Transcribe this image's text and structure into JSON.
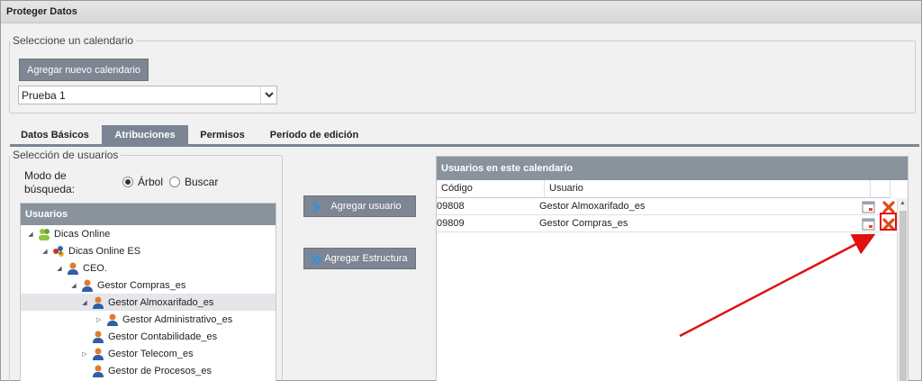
{
  "window": {
    "title": "Proteger Datos"
  },
  "calendar_section": {
    "legend": "Seleccione un calendario",
    "add_button": "Agregar nuevo calendario",
    "selected_calendar": "Prueba 1"
  },
  "tabs": [
    {
      "label": "Datos Básicos",
      "active": false
    },
    {
      "label": "Atribuciones",
      "active": true
    },
    {
      "label": "Permisos",
      "active": false
    },
    {
      "label": "Período de edición",
      "active": false
    }
  ],
  "user_selection": {
    "legend": "Selección de usuarios",
    "mode_label": "Modo de búsqueda:",
    "mode_options": [
      {
        "label": "Árbol",
        "selected": true
      },
      {
        "label": "Buscar",
        "selected": false
      }
    ],
    "tree_header": "Usuarios",
    "tree_nodes": [
      {
        "label": "Dicas Online",
        "caret": "expanded",
        "icon": "group-icon"
      },
      {
        "label": "Dicas Online ES",
        "caret": "expanded",
        "icon": "organization-icon"
      },
      {
        "label": "CEO.",
        "caret": "expanded",
        "icon": "user-icon"
      },
      {
        "label": "Gestor Compras_es",
        "caret": "expanded",
        "icon": "user-icon"
      },
      {
        "label": "Gestor Almoxarifado_es",
        "caret": "expanded",
        "icon": "user-icon",
        "selected": true
      },
      {
        "label": "Gestor Administrativo_es",
        "caret": "collapsed",
        "icon": "user-icon"
      },
      {
        "label": "Gestor Contabilidade_es",
        "caret": "none",
        "icon": "user-icon"
      },
      {
        "label": "Gestor Telecom_es",
        "caret": "collapsed",
        "icon": "user-icon"
      },
      {
        "label": "Gestor de Procesos_es",
        "caret": "none",
        "icon": "user-icon"
      }
    ]
  },
  "actions": {
    "add_user": "Agregar usuario",
    "add_structure": "Agregar Estructura"
  },
  "users_in_calendar": {
    "header": "Usuarios en este calendario",
    "columns": [
      "Código",
      "Usuario"
    ],
    "rows": [
      {
        "code": "09808",
        "user": "Gestor Almoxarifado_es"
      },
      {
        "code": "09809",
        "user": "Gestor Compras_es"
      }
    ]
  },
  "colors": {
    "accent": "#7a8493",
    "button": "#7d8692",
    "delete_icon": "#e04a1a",
    "annotation": "#e01010"
  }
}
